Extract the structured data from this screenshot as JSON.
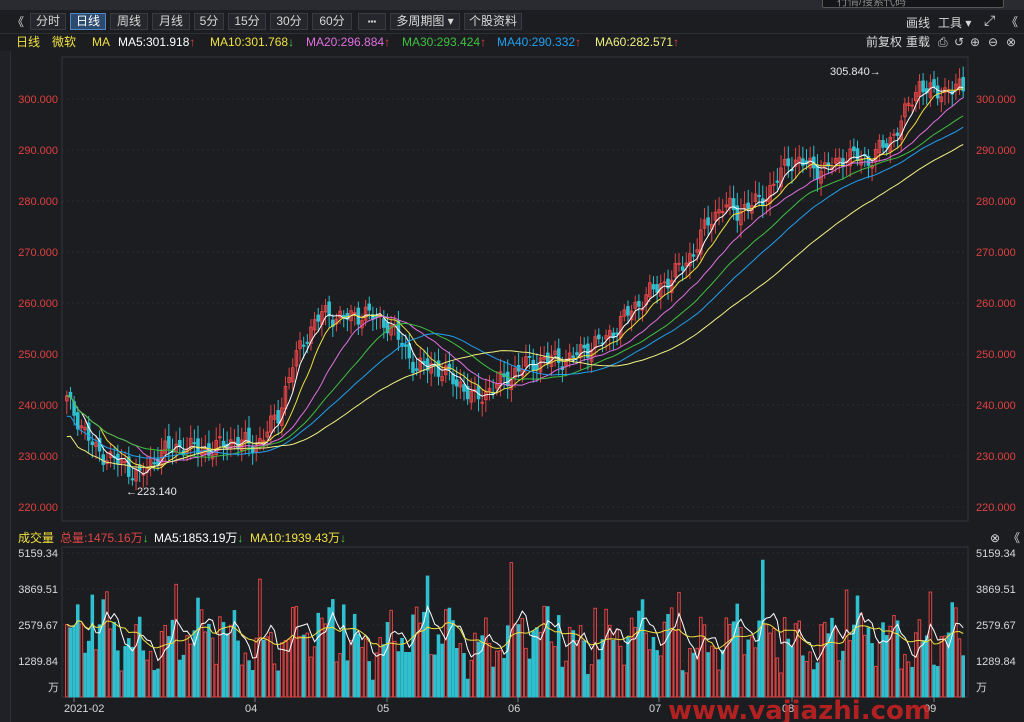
{
  "toolbar": {
    "collapse_left": "《",
    "tabs": [
      {
        "label": "分时",
        "active": false
      },
      {
        "label": "日线",
        "active": true
      },
      {
        "label": "周线",
        "active": false
      },
      {
        "label": "月线",
        "active": false
      },
      {
        "label": "5分",
        "active": false
      },
      {
        "label": "15分",
        "active": false
      },
      {
        "label": "30分",
        "active": false
      },
      {
        "label": "60分",
        "active": false
      }
    ],
    "more_label": "▪▪▪",
    "multi_period_label": "多周期图 ▾",
    "stock_info_label": "个股资料",
    "draw_label": "画线",
    "tools_label": "工具 ▾",
    "fullscreen_label": "⤢",
    "collapse_right": "《"
  },
  "top_search_placeholder": "行情/搜索代码",
  "legend": {
    "period": "日线",
    "name": "微软",
    "ma_label": "MA",
    "ma5": "MA5:301.918",
    "ma10": "MA10:301.768",
    "ma20": "MA20:296.884",
    "ma30": "MA30:293.424",
    "ma40": "MA40:290.332",
    "ma60": "MA60:282.571",
    "arrow_up": "↑",
    "arrow_down": "↓",
    "adjust_label": "前复权",
    "overlay_label": "重载"
  },
  "colors": {
    "up": "#e04545",
    "down": "#2fc0d0",
    "ma5": "#ffffff",
    "ma10": "#f0e040",
    "ma20": "#e070e0",
    "ma30": "#40c040",
    "ma40": "#20a0f0",
    "ma60": "#f0f080",
    "axis_text": "#e04040"
  },
  "price_axis": {
    "ticks": [
      "300.000",
      "290.000",
      "280.000",
      "270.000",
      "260.000",
      "250.000",
      "240.000",
      "230.000",
      "220.000"
    ],
    "high_label": "305.840",
    "low_label": "223.140"
  },
  "volume_legend": {
    "title": "成交量",
    "total": "总量:1475.16万",
    "ma5": "MA5:1853.19万",
    "ma10": "MA10:1939.43万"
  },
  "volume_axis": {
    "ticks": [
      "5159.34",
      "3869.51",
      "2579.67",
      "1289.84"
    ],
    "unit": "万"
  },
  "x_axis": {
    "labels": [
      "2021-02",
      "04",
      "05",
      "06",
      "07",
      "08",
      "09"
    ]
  },
  "watermark": "www.vajiazhi.com",
  "chart_data": {
    "type": "candlestick",
    "ylim": [
      218,
      310
    ],
    "volume_ylim": [
      0,
      5159.34
    ],
    "high": 305.84,
    "low": 223.14,
    "ma_last": {
      "ma5": 301.918,
      "ma10": 301.768,
      "ma20": 296.884,
      "ma30": 293.424,
      "ma40": 290.332,
      "ma60": 282.571
    }
  }
}
